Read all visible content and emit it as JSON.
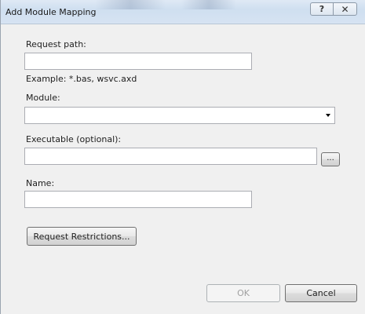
{
  "window": {
    "title": "Add Module Mapping",
    "help_glyph": "?",
    "close_glyph": "✕"
  },
  "form": {
    "request_path_label": "Request path:",
    "request_path_value": "",
    "request_path_example": "Example: *.bas, wsvc.axd",
    "module_label": "Module:",
    "module_value": "",
    "executable_label": "Executable (optional):",
    "executable_value": "",
    "browse_label": "...",
    "name_label": "Name:",
    "name_value": "",
    "request_restrictions_label": "Request Restrictions..."
  },
  "footer": {
    "ok_label": "OK",
    "ok_enabled": false,
    "cancel_label": "Cancel"
  },
  "icons": {
    "help": "help-icon",
    "close": "close-icon",
    "dropdown": "chevron-down-icon"
  }
}
